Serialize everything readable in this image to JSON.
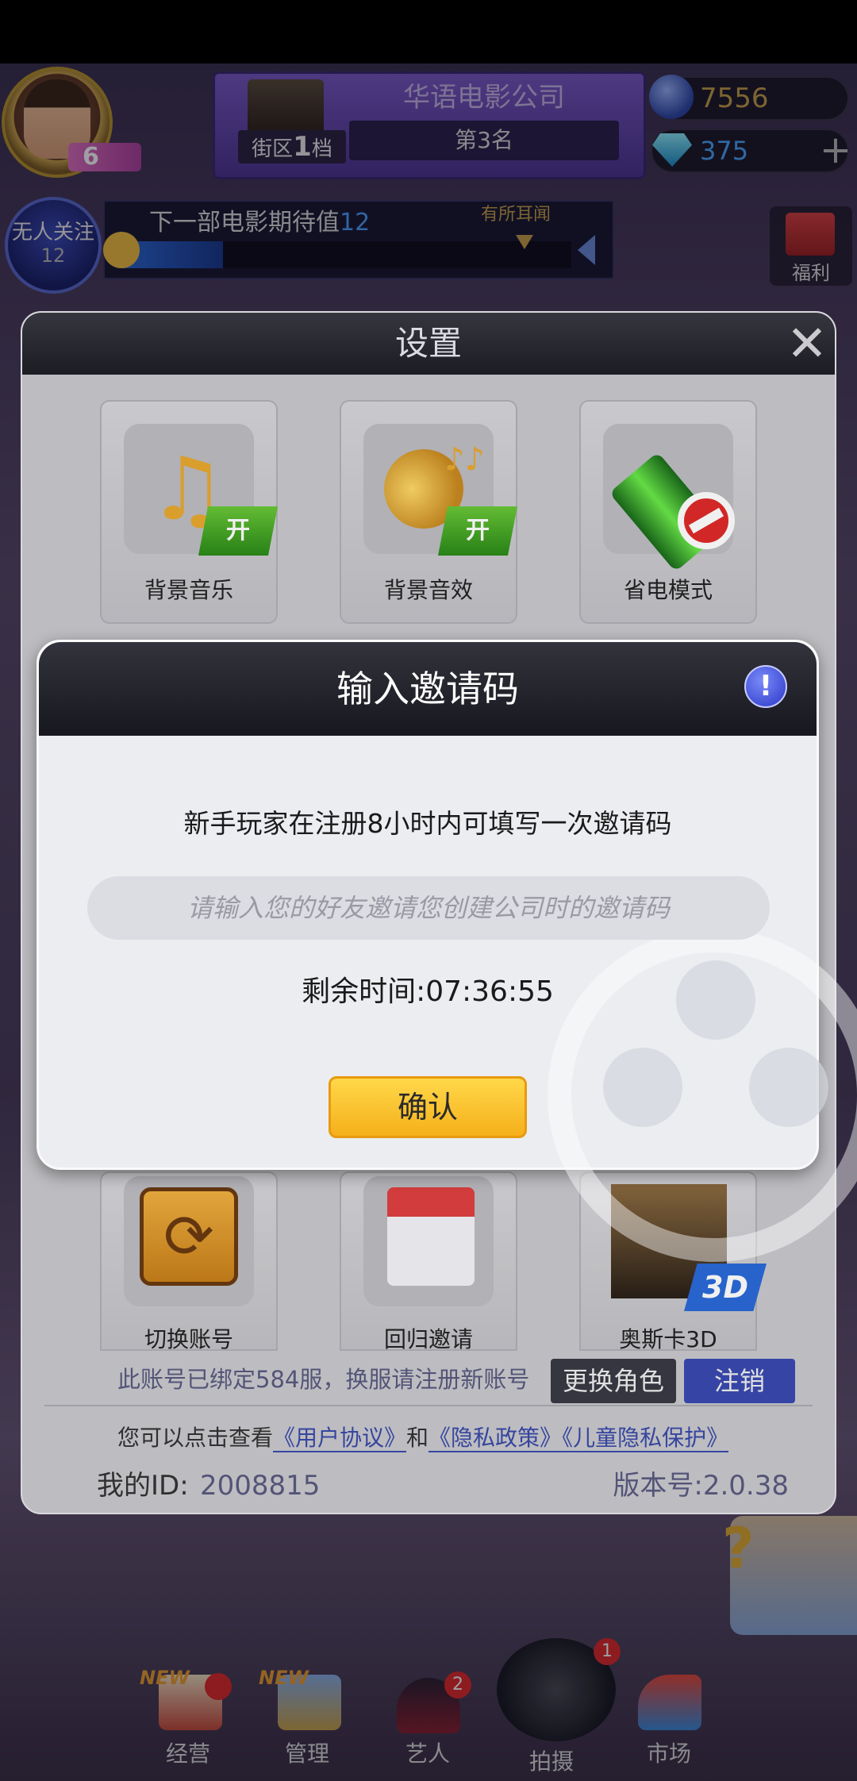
{
  "hud": {
    "level": "6",
    "district": "街区",
    "district_tier": "1",
    "district_suffix": "档",
    "company_name": "华语电影公司",
    "rank": "第3名",
    "coins": "7556",
    "gems": "375",
    "plus": "+",
    "fans_label": "无人关注",
    "fans_count": "12",
    "expect_label": "下一部电影期待值",
    "expect_value": "12",
    "expect_tier": "有所耳闻",
    "expect_progress": 0.23,
    "welfare": "福利"
  },
  "settings": {
    "title": "设置",
    "close": "✕",
    "tiles": {
      "bgm": {
        "label": "背景音乐",
        "state": "开"
      },
      "sfx": {
        "label": "背景音效",
        "state": "开"
      },
      "power": {
        "label": "省电模式"
      },
      "switch": {
        "label": "切换账号"
      },
      "return": {
        "label": "回归邀请"
      },
      "oscar": {
        "label": "奥斯卡3D",
        "badge": "3D"
      }
    },
    "bound_text": "此账号已绑定584服，换服请注册新账号",
    "change_role": "更换角色",
    "logout": "注销",
    "agreement_prefix": "您可以点击查看",
    "user_agreement": "《用户协议》",
    "and": "和",
    "privacy_policy": "《隐私政策》",
    "child_privacy": "《儿童隐私保护》",
    "my_id_label": "我的ID:",
    "my_id": "2008815",
    "version": "版本号:2.0.38"
  },
  "invite": {
    "title": "输入邀请码",
    "info_icon": "!",
    "description": "新手玩家在注册8小时内可填写一次邀请码",
    "input_placeholder": "请输入您的好友邀请您创建公司时的邀请码",
    "input_value": "",
    "remaining": "剩余时间:07:36:55",
    "confirm": "确认"
  },
  "nav": {
    "new_tag": "NEW",
    "items": [
      {
        "label": "经营"
      },
      {
        "label": "管理"
      },
      {
        "label": "艺人",
        "badge": "2"
      },
      {
        "label": "拍摄",
        "badge": "1"
      },
      {
        "label": "市场"
      }
    ]
  },
  "help": "?",
  "colors": {
    "accent_yellow": "#f5b01a",
    "link_blue": "#3a4aa8",
    "on_green": "#2a8a18",
    "logout_blue": "#3a4ab0"
  }
}
